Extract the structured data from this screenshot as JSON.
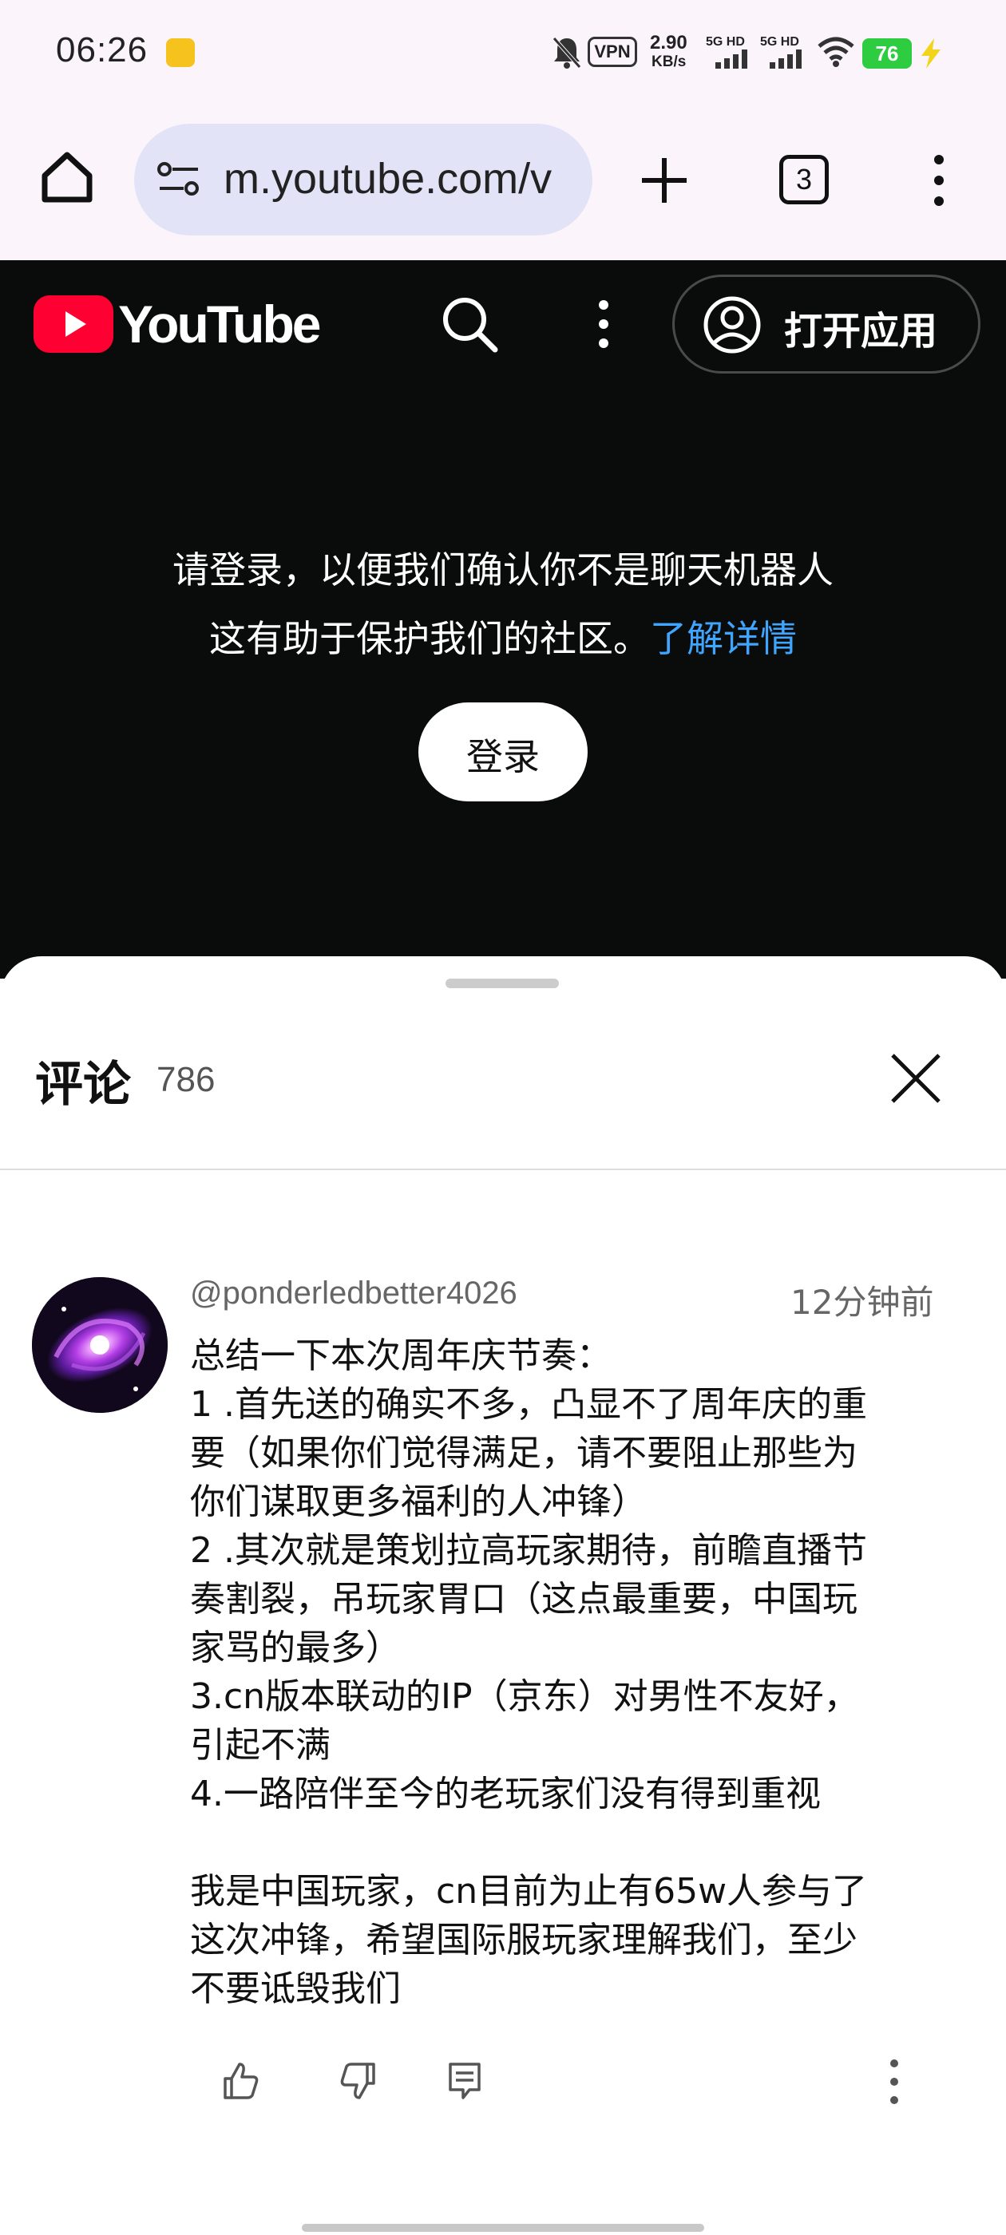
{
  "status_bar": {
    "time": "06:26",
    "vpn": "VPN",
    "net_speed_value": "2.90",
    "net_speed_unit": "KB/s",
    "signal1_label": "5G HD",
    "signal2_label": "5G HD",
    "battery": "76"
  },
  "browser": {
    "url": "m.youtube.com/v",
    "tab_count": "3"
  },
  "youtube_header": {
    "logo_text": "YouTube",
    "open_app_label": "打开应用"
  },
  "signin_prompt": {
    "line1": "请登录，以便我们确认你不是聊天机器人",
    "line2": "这有助于保护我们的社区。",
    "learn_more": "了解详情",
    "login_button": "登录"
  },
  "comments": {
    "title": "评论",
    "count": "786",
    "items": [
      {
        "author": "@ponderledbetter4026",
        "time_ago": "12分钟前",
        "lines": [
          "总结一下本次周年庆节奏：",
          "1 .首先送的确实不多，凸显不了周年庆的重",
          "要（如果你们觉得满足，请不要阻止那些为",
          "你们谋取更多福利的人冲锋）",
          "2 .其次就是策划拉高玩家期待，前瞻直播节",
          "奏割裂，吊玩家胃口（这点最重要，中国玩",
          "家骂的最多）",
          "3.cn版本联动的IP（京东）对男性不友好，",
          "引起不满",
          "4.一路陪伴至今的老玩家们没有得到重视",
          "",
          "我是中国玩家，cn目前为止有65w人参与了",
          "这次冲锋，希望国际服玩家理解我们，至少",
          "不要诋毁我们"
        ]
      }
    ]
  },
  "colors": {
    "youtube_red": "#ff0033",
    "link_blue": "#3ea6ff",
    "dark_bg": "#0a0c0c",
    "battery_green": "#2ecc40"
  }
}
